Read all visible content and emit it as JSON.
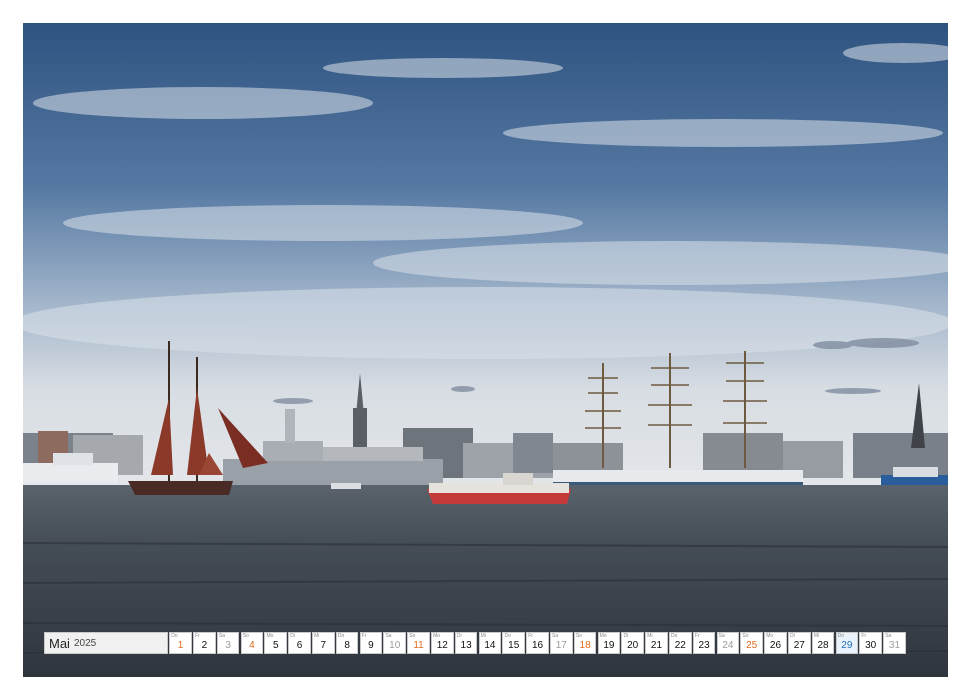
{
  "calendar": {
    "month": "Mai",
    "year": "2025",
    "days": [
      {
        "wd": "Do",
        "n": "1",
        "type": "hol"
      },
      {
        "wd": "Fr",
        "n": "2",
        "type": ""
      },
      {
        "wd": "Sa",
        "n": "3",
        "type": "sat"
      },
      {
        "wd": "So",
        "n": "4",
        "type": "sun"
      },
      {
        "wd": "Mo",
        "n": "5",
        "type": ""
      },
      {
        "wd": "Di",
        "n": "6",
        "type": ""
      },
      {
        "wd": "Mi",
        "n": "7",
        "type": ""
      },
      {
        "wd": "Do",
        "n": "8",
        "type": ""
      },
      {
        "wd": "Fr",
        "n": "9",
        "type": ""
      },
      {
        "wd": "Sa",
        "n": "10",
        "type": "sat"
      },
      {
        "wd": "So",
        "n": "11",
        "type": "sun"
      },
      {
        "wd": "Mo",
        "n": "12",
        "type": ""
      },
      {
        "wd": "Di",
        "n": "13",
        "type": ""
      },
      {
        "wd": "Mi",
        "n": "14",
        "type": ""
      },
      {
        "wd": "Do",
        "n": "15",
        "type": ""
      },
      {
        "wd": "Fr",
        "n": "16",
        "type": ""
      },
      {
        "wd": "Sa",
        "n": "17",
        "type": "sat"
      },
      {
        "wd": "So",
        "n": "18",
        "type": "sun"
      },
      {
        "wd": "Mo",
        "n": "19",
        "type": ""
      },
      {
        "wd": "Di",
        "n": "20",
        "type": ""
      },
      {
        "wd": "Mi",
        "n": "21",
        "type": ""
      },
      {
        "wd": "Do",
        "n": "22",
        "type": ""
      },
      {
        "wd": "Fr",
        "n": "23",
        "type": ""
      },
      {
        "wd": "Sa",
        "n": "24",
        "type": "sat"
      },
      {
        "wd": "So",
        "n": "25",
        "type": "sun"
      },
      {
        "wd": "Mo",
        "n": "26",
        "type": ""
      },
      {
        "wd": "Di",
        "n": "27",
        "type": ""
      },
      {
        "wd": "Mi",
        "n": "28",
        "type": ""
      },
      {
        "wd": "Do",
        "n": "29",
        "type": "blue"
      },
      {
        "wd": "Fr",
        "n": "30",
        "type": ""
      },
      {
        "wd": "Sa",
        "n": "31",
        "type": "sat"
      }
    ]
  },
  "colors": {
    "sky_top": "#35587f",
    "sky_mid": "#6d8db0",
    "cloud": "#d9dee4",
    "water": "#3d4550",
    "sail_red": "#8b3a2a",
    "sunday": "#e06a1b",
    "holiday_blue": "#1e6fb8"
  }
}
